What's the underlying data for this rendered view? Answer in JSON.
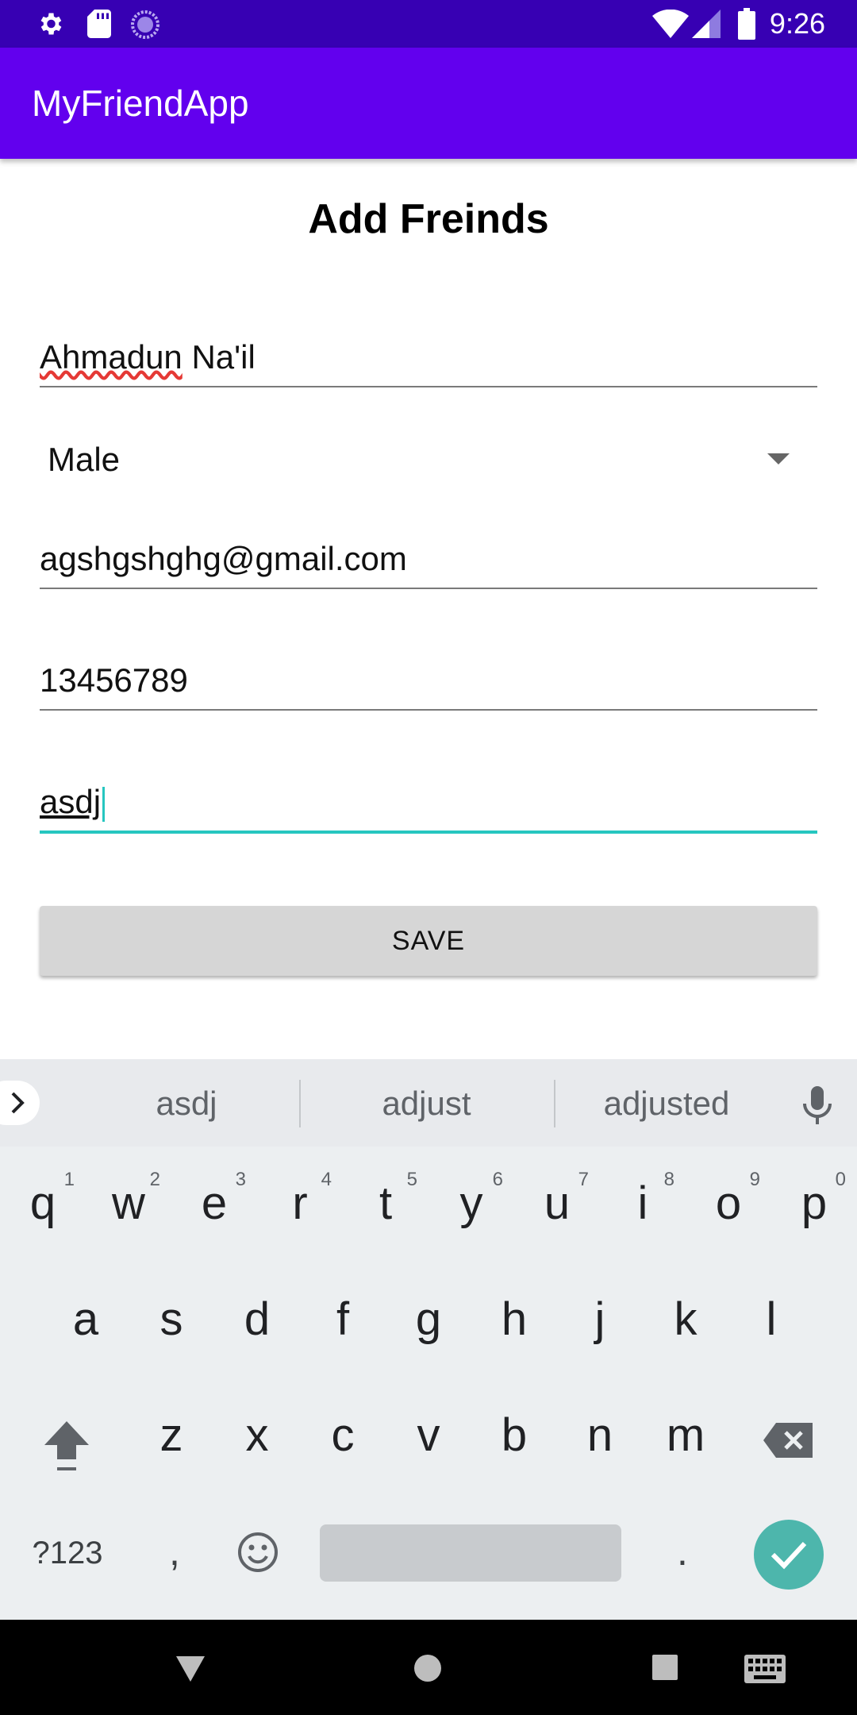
{
  "status_bar": {
    "time": "9:26",
    "icons": [
      "gear-icon",
      "sd-card-icon",
      "sync-circle-icon",
      "wifi-icon",
      "signal-icon",
      "battery-icon"
    ]
  },
  "app_bar": {
    "title": "MyFriendApp"
  },
  "form": {
    "heading": "Add Freinds",
    "name_value_misspelled": "Ahmadun",
    "name_value_rest": " Na'il",
    "gender_selected": "Male",
    "email_value": "agshgshghg@gmail.com",
    "phone_value": "13456789",
    "address_value": "asdj",
    "save_label": "SAVE"
  },
  "keyboard": {
    "suggestions": [
      "asdj",
      "adjust",
      "adjusted"
    ],
    "row1": [
      {
        "key": "q",
        "hint": "1"
      },
      {
        "key": "w",
        "hint": "2"
      },
      {
        "key": "e",
        "hint": "3"
      },
      {
        "key": "r",
        "hint": "4"
      },
      {
        "key": "t",
        "hint": "5"
      },
      {
        "key": "y",
        "hint": "6"
      },
      {
        "key": "u",
        "hint": "7"
      },
      {
        "key": "i",
        "hint": "8"
      },
      {
        "key": "o",
        "hint": "9"
      },
      {
        "key": "p",
        "hint": "0"
      }
    ],
    "row2": [
      "a",
      "s",
      "d",
      "f",
      "g",
      "h",
      "j",
      "k",
      "l"
    ],
    "row3": [
      "z",
      "x",
      "c",
      "v",
      "b",
      "n",
      "m"
    ],
    "symbols_label": "?123",
    "comma_label": ",",
    "period_label": "."
  },
  "colors": {
    "status_bar": "#3700b3",
    "app_bar": "#6200ee",
    "focus_underline": "#26c6c0",
    "enter_key": "#4db6ac"
  }
}
